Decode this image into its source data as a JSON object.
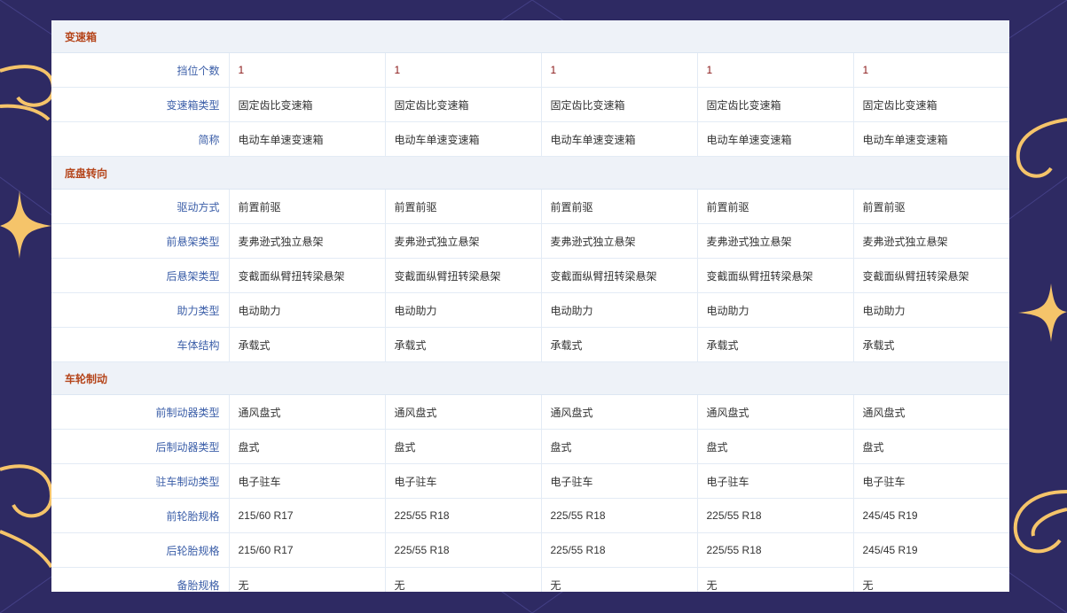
{
  "colors": {
    "background": "#2e2a63",
    "ornament": "#f5c46a",
    "section_text": "#b5451b",
    "label_text": "#3b5ea8",
    "section_bg": "#eef2f8"
  },
  "sections": [
    {
      "title": "变速箱",
      "rows": [
        {
          "label": "挡位个数",
          "values": [
            "1",
            "1",
            "1",
            "1",
            "1"
          ]
        },
        {
          "label": "变速箱类型",
          "values": [
            "固定齿比变速箱",
            "固定齿比变速箱",
            "固定齿比变速箱",
            "固定齿比变速箱",
            "固定齿比变速箱"
          ]
        },
        {
          "label": "简称",
          "values": [
            "电动车单速变速箱",
            "电动车单速变速箱",
            "电动车单速变速箱",
            "电动车单速变速箱",
            "电动车单速变速箱"
          ]
        }
      ]
    },
    {
      "title": "底盘转向",
      "rows": [
        {
          "label": "驱动方式",
          "values": [
            "前置前驱",
            "前置前驱",
            "前置前驱",
            "前置前驱",
            "前置前驱"
          ]
        },
        {
          "label": "前悬架类型",
          "values": [
            "麦弗逊式独立悬架",
            "麦弗逊式独立悬架",
            "麦弗逊式独立悬架",
            "麦弗逊式独立悬架",
            "麦弗逊式独立悬架"
          ]
        },
        {
          "label": "后悬架类型",
          "values": [
            "变截面纵臂扭转梁悬架",
            "变截面纵臂扭转梁悬架",
            "变截面纵臂扭转梁悬架",
            "变截面纵臂扭转梁悬架",
            "变截面纵臂扭转梁悬架"
          ]
        },
        {
          "label": "助力类型",
          "values": [
            "电动助力",
            "电动助力",
            "电动助力",
            "电动助力",
            "电动助力"
          ]
        },
        {
          "label": "车体结构",
          "values": [
            "承载式",
            "承载式",
            "承载式",
            "承载式",
            "承载式"
          ]
        }
      ]
    },
    {
      "title": "车轮制动",
      "rows": [
        {
          "label": "前制动器类型",
          "values": [
            "通风盘式",
            "通风盘式",
            "通风盘式",
            "通风盘式",
            "通风盘式"
          ]
        },
        {
          "label": "后制动器类型",
          "values": [
            "盘式",
            "盘式",
            "盘式",
            "盘式",
            "盘式"
          ]
        },
        {
          "label": "驻车制动类型",
          "values": [
            "电子驻车",
            "电子驻车",
            "电子驻车",
            "电子驻车",
            "电子驻车"
          ]
        },
        {
          "label": "前轮胎规格",
          "values": [
            "215/60 R17",
            "225/55 R18",
            "225/55 R18",
            "225/55 R18",
            "245/45 R19"
          ]
        },
        {
          "label": "后轮胎规格",
          "values": [
            "215/60 R17",
            "225/55 R18",
            "225/55 R18",
            "225/55 R18",
            "245/45 R19"
          ]
        },
        {
          "label": "备胎规格",
          "values": [
            "无",
            "无",
            "无",
            "无",
            "无"
          ]
        }
      ]
    }
  ]
}
